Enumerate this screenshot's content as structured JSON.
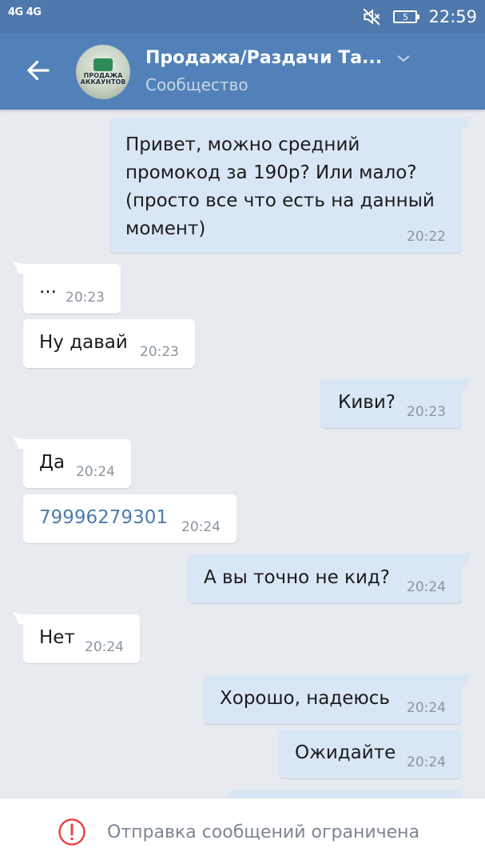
{
  "status_bar": {
    "network": "4G 4G",
    "battery_level": "5",
    "time": "22:59"
  },
  "header": {
    "avatar_text": "ПРОДАЖА АККАУНТОВ",
    "title": "Продажа/Раздачи Та...",
    "subtitle": "Сообщество"
  },
  "messages": [
    {
      "side": "out",
      "lines": [
        "Привет, можно средний",
        "промокод за 190р? Или мало?",
        "(просто все что есть на данный",
        "момент)"
      ],
      "time": "20:22"
    },
    {
      "side": "in",
      "text": "...",
      "time": "20:23"
    },
    {
      "side": "in",
      "text": "Ну давай",
      "time": "20:23"
    },
    {
      "side": "out",
      "text": "Киви?",
      "time": "20:23"
    },
    {
      "side": "in",
      "text": "Да",
      "time": "20:24"
    },
    {
      "side": "in",
      "text": "79996279301",
      "time": "20:24"
    },
    {
      "side": "out",
      "text": "А вы точно не кид?",
      "time": "20:24"
    },
    {
      "side": "in",
      "text": "Нет",
      "time": "20:24"
    },
    {
      "side": "out",
      "text": "Хорошо, надеюсь",
      "time": "20:24"
    },
    {
      "side": "out",
      "text": "Ожидайте",
      "time": "20:24"
    }
  ],
  "bottom_bar": {
    "restriction_text": "Отправка сообщений ограничена"
  },
  "colors": {
    "header_bg": "#5181b8",
    "incoming_bubble": "#ffffff",
    "outgoing_bubble": "#d9e6f5",
    "link": "#4d7bb0",
    "warning": "#e64646"
  }
}
